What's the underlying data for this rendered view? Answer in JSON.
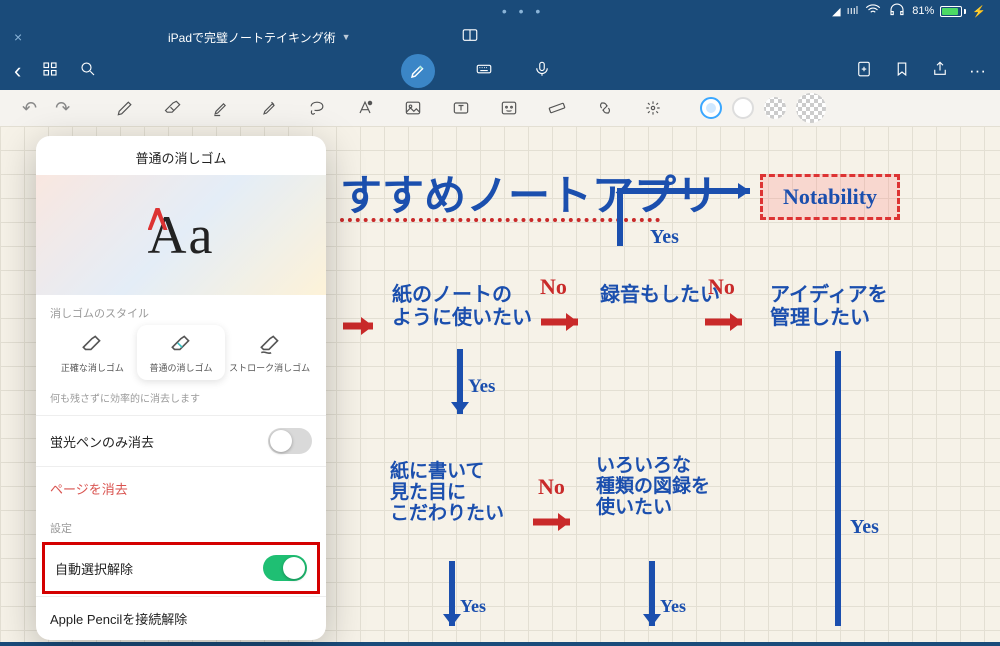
{
  "status": {
    "battery_pct": "81%",
    "battery_icon": "battery-charging",
    "icons": [
      "location-icon",
      "signal-icon",
      "wifi-icon",
      "headphones-icon"
    ]
  },
  "titlebar": {
    "document_title": "iPadで完璧ノートテイキング術",
    "close_label": "×"
  },
  "nav": {
    "back": "‹",
    "apps": "apps-grid",
    "search": "search",
    "pen": "pen",
    "keyboard": "keyboard",
    "mic": "mic",
    "add": "add-page",
    "bookmark": "bookmark",
    "share": "share",
    "more": "···"
  },
  "toolbar": {
    "undo": "↶",
    "redo": "↷",
    "tools": [
      "pen",
      "eraser",
      "highlighter",
      "shape",
      "lasso",
      "text-style",
      "image",
      "text-box",
      "sticker",
      "ruler",
      "link",
      "laser"
    ],
    "active_tool": "eraser"
  },
  "eraser_panel": {
    "title": "普通の消しゴム",
    "preview_text": "Aa",
    "style_section": "消しゴムのスタイル",
    "styles": [
      {
        "label": "正確な消しゴム"
      },
      {
        "label": "普通の消しゴム",
        "selected": true
      },
      {
        "label": "ストローク消しゴム"
      }
    ],
    "hint": "何も残さずに効率的に消去します",
    "highlighter_only": {
      "label": "蛍光ペンのみ消去",
      "value": false
    },
    "clear_page": "ページを消去",
    "settings_section": "設定",
    "auto_deselect": {
      "label": "自動選択解除",
      "value": true
    },
    "disconnect_pencil": "Apple Pencilを接続解除"
  },
  "handwriting": {
    "title": "すすめノートアプリ",
    "notability": "Notability",
    "q1": "紙のノートの\nように使いたい",
    "q2": "録音もしたい",
    "q3": "アイディアを\n管理したい",
    "q4": "紙に書いて\n見た目に\nこだわりたい",
    "q5": "いろいろな\n種類の図録を\n使いたい",
    "yes": "Yes",
    "no": "No"
  }
}
